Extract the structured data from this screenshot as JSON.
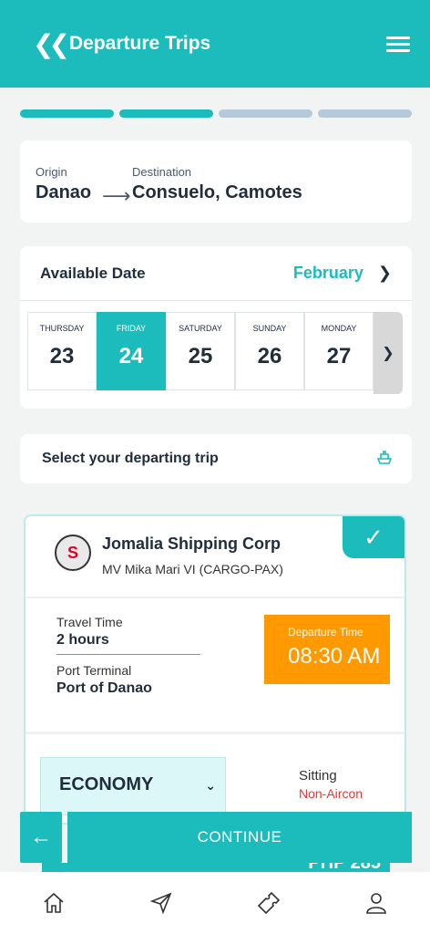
{
  "header": {
    "title": "Departure Trips",
    "back_icon": "double-chevron-left-icon",
    "menu_icon": "hamburger-icon"
  },
  "progress": {
    "steps_total": 4,
    "steps_done": 2,
    "colors": {
      "done": "#1cbcbc",
      "todo": "#b5c9da"
    }
  },
  "route": {
    "origin_label": "Origin",
    "origin": "Danao",
    "destination_label": "Destination",
    "destination": "Consuelo, Camotes"
  },
  "dates": {
    "title": "Available Date",
    "month": "February",
    "days": [
      {
        "name": "THURSDAY",
        "num": "23"
      },
      {
        "name": "FRIDAY",
        "num": "24",
        "selected": true
      },
      {
        "name": "SATURDAY",
        "num": "25"
      },
      {
        "name": "SUNDAY",
        "num": "26"
      },
      {
        "name": "MONDAY",
        "num": "27"
      }
    ]
  },
  "select_trip": {
    "label": "Select your departing trip",
    "icon": "ship-icon"
  },
  "trip": {
    "company": "Jomalia Shipping Corp",
    "vessel": "MV Mika Mari VI (CARGO-PAX)",
    "travel_time_label": "Travel Time",
    "travel_time": "2 hours",
    "port_label": "Port Terminal",
    "port": "Port of Danao",
    "departure_label": "Departure Time",
    "departure": "08:30 AM",
    "class": "ECONOMY",
    "seat_type": "Sitting",
    "aircon": "Non-Aircon",
    "price_partial": "PHP 285"
  },
  "actions": {
    "continue": "CONTINUE"
  },
  "accent": "#1cbcbc",
  "departure_color": "#ff9900"
}
